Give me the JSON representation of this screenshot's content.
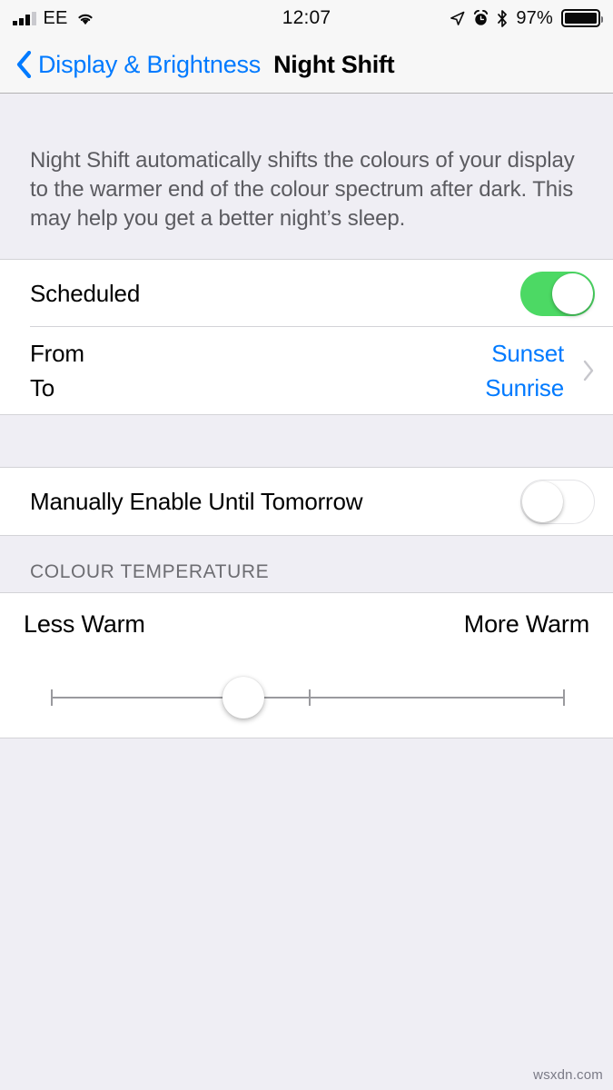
{
  "status_bar": {
    "carrier": "EE",
    "time": "12:07",
    "battery_percent": "97%",
    "icons": {
      "signal": "signal-bars-icon",
      "wifi": "wifi-icon",
      "location": "location-arrow-icon",
      "alarm": "alarm-clock-icon",
      "bluetooth": "bluetooth-icon",
      "battery": "battery-icon"
    },
    "signal_bars_filled": 3,
    "signal_bars_total": 4
  },
  "nav": {
    "back_label": "Display & Brightness",
    "title": "Night Shift",
    "back_icon": "chevron-left-icon"
  },
  "intro": {
    "text": "Night Shift automatically shifts the colours of your display to the warmer end of the colour spectrum after dark. This may help you get a better night’s sleep."
  },
  "schedule_section": {
    "scheduled_label": "Scheduled",
    "scheduled_enabled": true,
    "from_label": "From",
    "to_label": "To",
    "from_value": "Sunset",
    "to_value": "Sunrise",
    "disclosure_icon": "chevron-right-icon"
  },
  "manual_section": {
    "label": "Manually Enable Until Tomorrow",
    "enabled": false
  },
  "colour_temperature": {
    "header": "COLOUR TEMPERATURE",
    "min_label": "Less Warm",
    "max_label": "More Warm",
    "value_percent": 37.5
  },
  "watermark": "wsxdn.com",
  "colors": {
    "accent_blue": "#007AFF",
    "toggle_green": "#4CD964",
    "group_background": "#EFEEF4",
    "card_background": "#FFFFFF",
    "separator": "#D3D3D7",
    "secondary_text": "#6D6D72"
  }
}
